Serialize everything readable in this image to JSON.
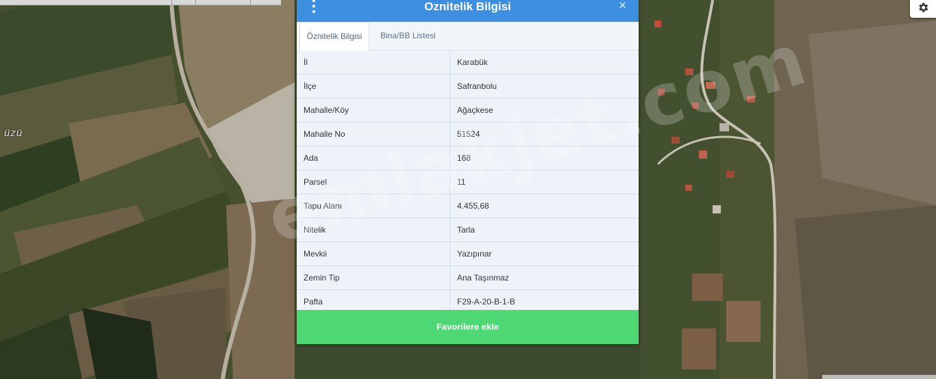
{
  "map": {
    "place_label": "üzü",
    "watermark": "emlakjet.com"
  },
  "dialog": {
    "title": "Oznitelik Bilgisi",
    "close_label": "×",
    "tabs": [
      {
        "label": "Öznitelik Bilgisi",
        "active": true
      },
      {
        "label": "Bina/BB Listesi",
        "active": false
      }
    ],
    "rows": [
      {
        "key": "İl",
        "value": "Karabük"
      },
      {
        "key": "İlçe",
        "value": "Safranbolu"
      },
      {
        "key": "Mahalle/Köy",
        "value": "Ağaçkese"
      },
      {
        "key": "Mahalle No",
        "value": "51524"
      },
      {
        "key": "Ada",
        "value": "168"
      },
      {
        "key": "Parsel",
        "value": "11"
      },
      {
        "key": "Tapu Alanı",
        "value": "4.455,68"
      },
      {
        "key": "Nitelik",
        "value": "Tarla"
      },
      {
        "key": "Mevkii",
        "value": "Yazıpınar"
      },
      {
        "key": "Zemin Tip",
        "value": "Ana Taşınmaz"
      },
      {
        "key": "Pafta",
        "value": "F29-A-20-B-1-B"
      }
    ],
    "favorite_button": "Favorilere ekle"
  },
  "icons": {
    "settings": "gear-icon",
    "menu": "kebab-menu-icon",
    "close": "close-icon"
  },
  "colors": {
    "header": "#3d8fe2",
    "favorite_button": "#4dd873"
  }
}
